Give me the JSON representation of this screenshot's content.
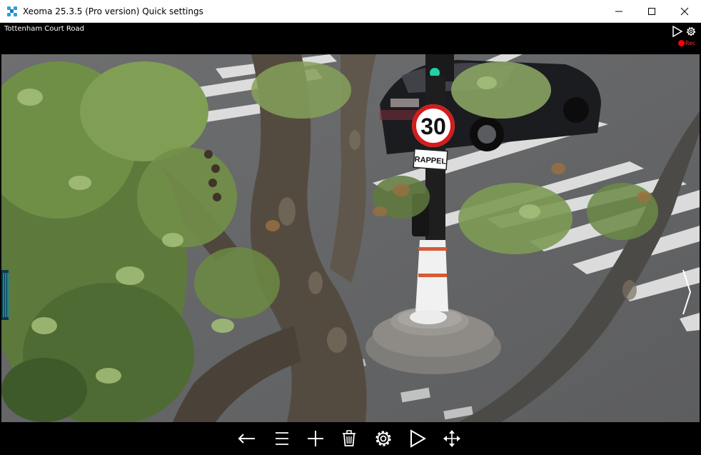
{
  "window": {
    "title": "Xeoma 25.3.5 (Pro version) Quick settings",
    "controls": [
      "minimize",
      "maximize",
      "close"
    ]
  },
  "camera": {
    "name": "Tottenham Court Road",
    "rec_label": "Rec",
    "sign_speed": "30",
    "sign_subtitle": "RAPPEL"
  },
  "toolbar": {
    "buttons": [
      "back-arrow-icon",
      "menu-icon",
      "add-icon",
      "trash-icon",
      "settings-icon",
      "play-icon",
      "move-icon"
    ]
  },
  "colors": {
    "accent": "#2aa0d8",
    "rec": "#ff0000"
  }
}
